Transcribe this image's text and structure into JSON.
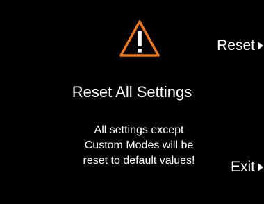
{
  "dialog": {
    "icon": "warning-triangle-icon",
    "title": "Reset All Settings",
    "message_lines": [
      "All settings except",
      "Custom Modes will be",
      "reset to default values!"
    ]
  },
  "softkeys": {
    "reset_label": "Reset",
    "exit_label": "Exit",
    "arrow_icon": "right-arrow-icon"
  },
  "colors": {
    "background": "#000000",
    "text": "#ffffff",
    "warning_accent": "#e87722"
  }
}
